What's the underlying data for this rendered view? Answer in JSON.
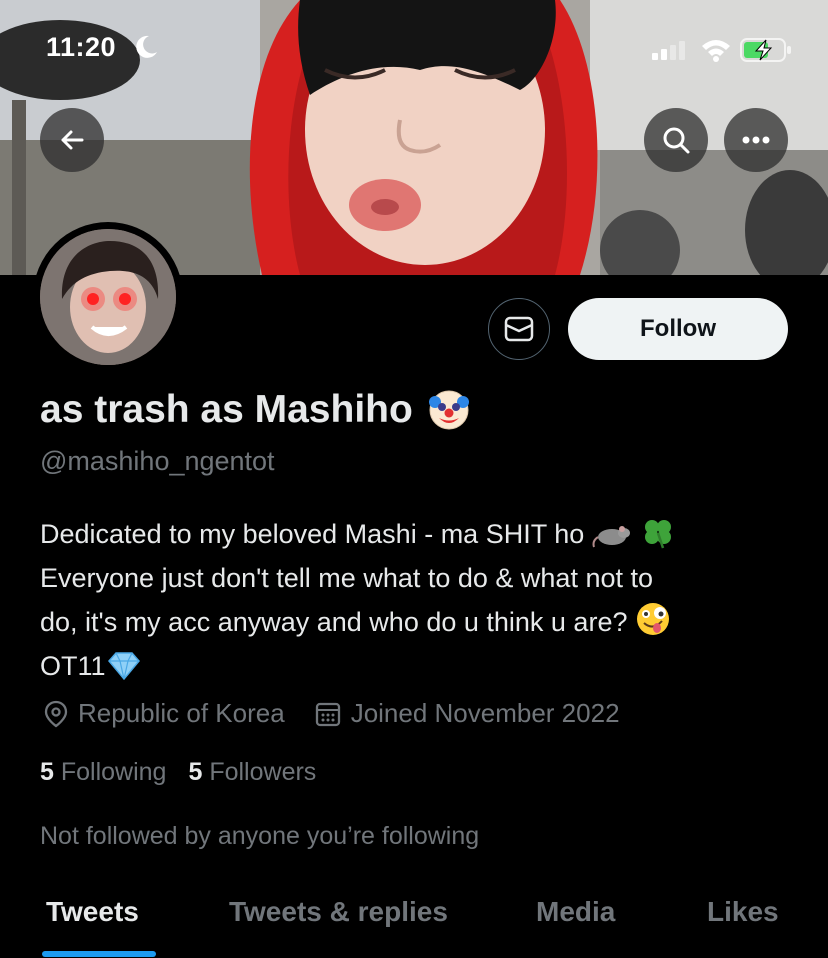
{
  "status_bar": {
    "time": "11:20"
  },
  "profile": {
    "display_name": "as trash as Mashiho",
    "handle": "@mashiho_ngentot",
    "bio_lines": [
      "Dedicated to my beloved Mashi - ma SHIT ho",
      "Everyone just don't tell me what to do & what not to",
      "do, it's my acc anyway and who do u think u are?",
      "OT11"
    ],
    "location": "Republic of Korea",
    "joined": "Joined November 2022",
    "following_count": "5",
    "following_label": "Following",
    "followers_count": "5",
    "followers_label": "Followers",
    "not_followed_text": "Not followed by anyone you’re following"
  },
  "actions": {
    "follow_label": "Follow"
  },
  "tabs": [
    {
      "label": "Tweets",
      "active": true
    },
    {
      "label": "Tweets & replies",
      "active": false
    },
    {
      "label": "Media",
      "active": false
    },
    {
      "label": "Likes",
      "active": false
    }
  ],
  "colors": {
    "background": "#000000",
    "text_primary": "#e7e9ea",
    "text_secondary": "#71767b",
    "accent": "#1d9bf0",
    "follow_button_bg": "#eff3f4",
    "hood_red": "#d6201f"
  },
  "icons": [
    "back-arrow-icon",
    "search-icon",
    "more-icon",
    "mail-icon",
    "location-pin-icon",
    "calendar-icon",
    "clown-emoji",
    "rat-emoji",
    "clover-emoji",
    "zany-face-emoji",
    "gem-emoji"
  ]
}
